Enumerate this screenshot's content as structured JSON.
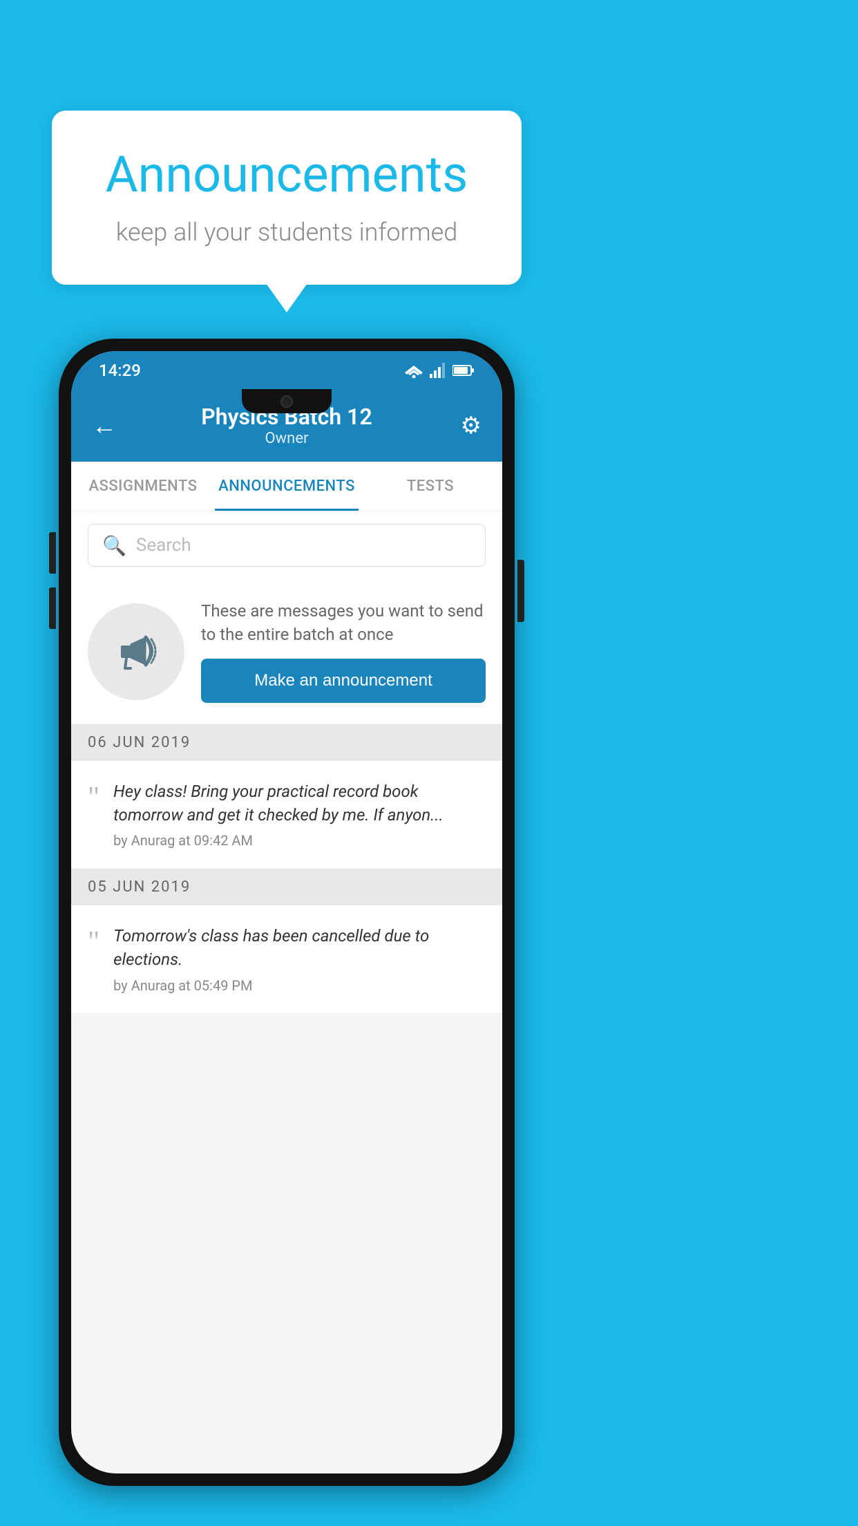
{
  "background_color": "#1BB8E8",
  "speech_bubble": {
    "title": "Announcements",
    "subtitle": "keep all your students informed"
  },
  "phone": {
    "status_bar": {
      "time": "14:29"
    },
    "app_bar": {
      "back_label": "←",
      "title": "Physics Batch 12",
      "subtitle": "Owner",
      "gear_label": "⚙"
    },
    "tabs": [
      {
        "label": "ASSIGNMENTS",
        "active": false
      },
      {
        "label": "ANNOUNCEMENTS",
        "active": true
      },
      {
        "label": "TESTS",
        "active": false
      }
    ],
    "search": {
      "placeholder": "Search"
    },
    "announcement_promo": {
      "description": "These are messages you want to send to the entire batch at once",
      "button_label": "Make an announcement"
    },
    "announcement_groups": [
      {
        "date": "06  JUN  2019",
        "items": [
          {
            "text": "Hey class! Bring your practical record book tomorrow and get it checked by me. If anyon...",
            "meta": "by Anurag at 09:42 AM"
          }
        ]
      },
      {
        "date": "05  JUN  2019",
        "items": [
          {
            "text": "Tomorrow's class has been cancelled due to elections.",
            "meta": "by Anurag at 05:49 PM"
          }
        ]
      }
    ]
  }
}
